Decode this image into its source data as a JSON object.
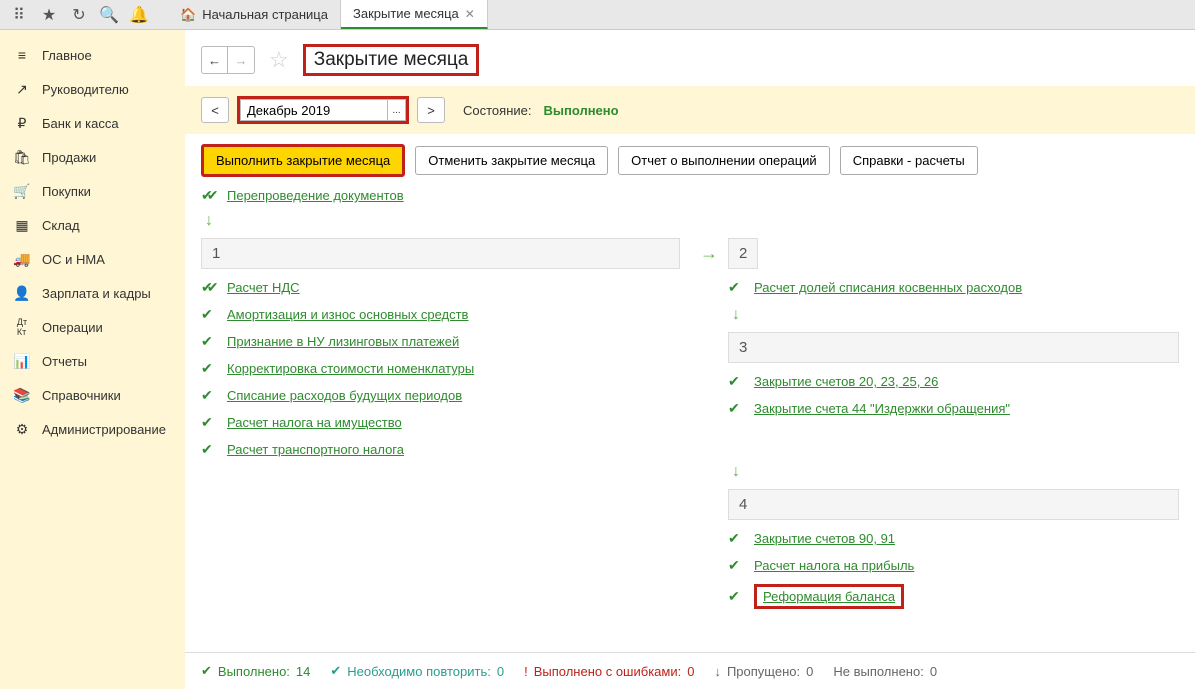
{
  "tabs": {
    "home": "Начальная страница",
    "active": "Закрытие месяца"
  },
  "sidebar": {
    "items": [
      {
        "icon": "≡",
        "label": "Главное"
      },
      {
        "icon": "↗",
        "label": "Руководителю"
      },
      {
        "icon": "₽",
        "label": "Банк и касса"
      },
      {
        "icon": "🛍",
        "label": "Продажи"
      },
      {
        "icon": "🛒",
        "label": "Покупки"
      },
      {
        "icon": "▦",
        "label": "Склад"
      },
      {
        "icon": "🚚",
        "label": "ОС и НМА"
      },
      {
        "icon": "👤",
        "label": "Зарплата и кадры"
      },
      {
        "icon": "Дт",
        "label": "Операции"
      },
      {
        "icon": "📊",
        "label": "Отчеты"
      },
      {
        "icon": "📚",
        "label": "Справочники"
      },
      {
        "icon": "⚙",
        "label": "Администрирование"
      }
    ]
  },
  "header": {
    "title": "Закрытие месяца"
  },
  "period": {
    "value": "Декабрь 2019",
    "status_label": "Состояние:",
    "status_value": "Выполнено"
  },
  "actions": {
    "run": "Выполнить закрытие месяца",
    "cancel": "Отменить закрытие месяца",
    "report": "Отчет о выполнении операций",
    "refs": "Справки - расчеты"
  },
  "first_step": "Перепроведение документов",
  "col1": {
    "num": "1",
    "items": [
      "Расчет НДС",
      "Амортизация и износ основных средств",
      "Признание в НУ лизинговых платежей",
      "Корректировка стоимости номенклатуры",
      "Списание расходов будущих периодов",
      "Расчет налога на имущество",
      "Расчет транспортного налога"
    ]
  },
  "col2": {
    "b1_num": "2",
    "b1_items": [
      "Расчет долей списания косвенных расходов"
    ],
    "b2_num": "3",
    "b2_items": [
      "Закрытие счетов 20, 23, 25, 26",
      "Закрытие счета 44 \"Издержки обращения\""
    ],
    "b3_num": "4",
    "b3_items": [
      "Закрытие счетов 90, 91",
      "Расчет налога на прибыль",
      "Реформация баланса"
    ]
  },
  "footer": {
    "done_label": "Выполнено:",
    "done_val": "14",
    "repeat_label": "Необходимо повторить:",
    "repeat_val": "0",
    "errors_label": "Выполнено с ошибками:",
    "errors_val": "0",
    "skipped_label": "Пропущено:",
    "skipped_val": "0",
    "notdone_label": "Не выполнено:",
    "notdone_val": "0"
  }
}
